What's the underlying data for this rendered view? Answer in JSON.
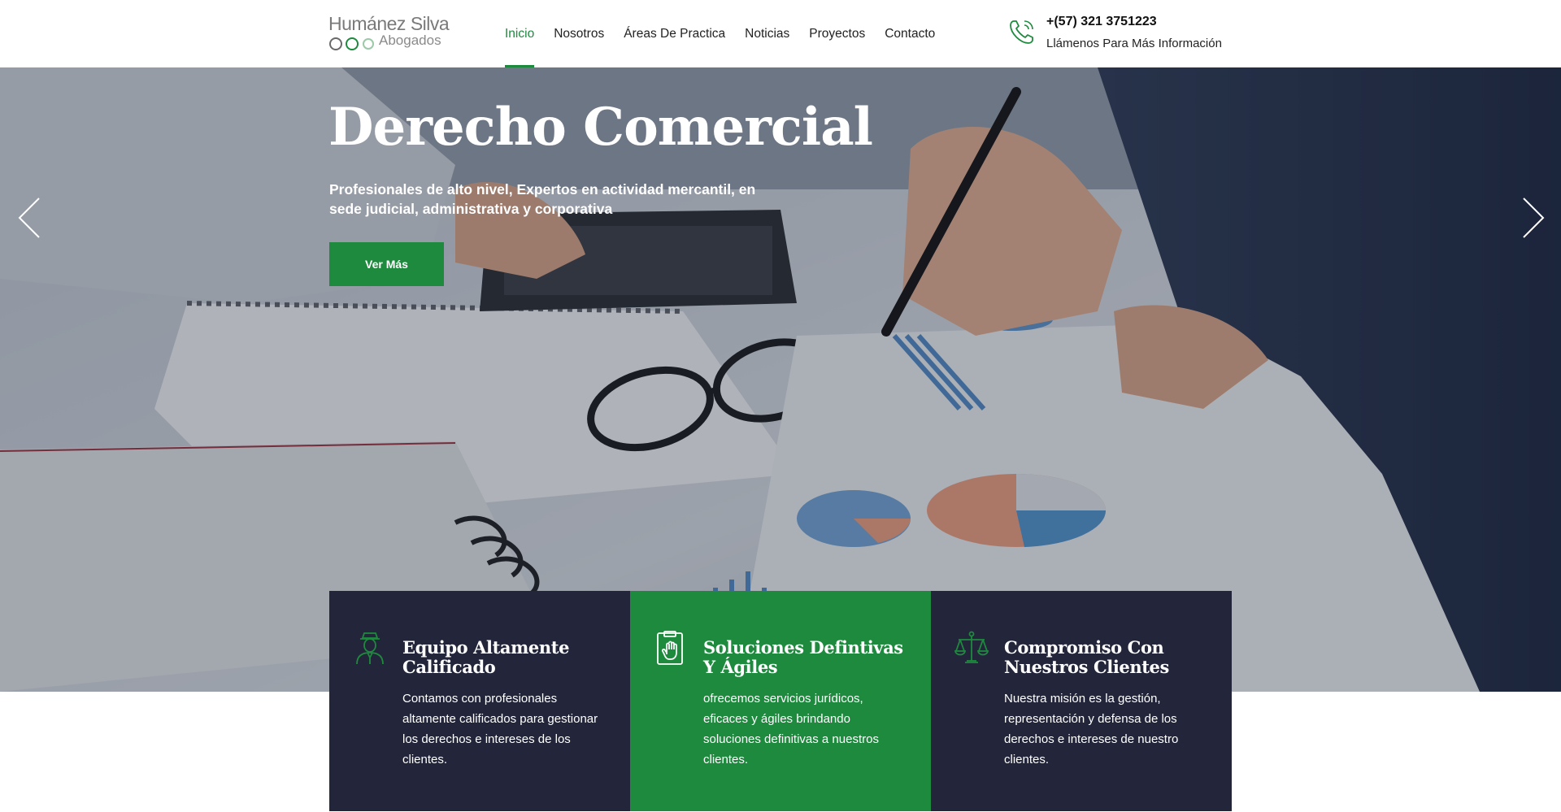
{
  "brand": {
    "name": "Humánez Silva",
    "subtitle": "Abogados",
    "green": "#1e8a3e",
    "navy": "#23263a"
  },
  "nav": {
    "items": [
      {
        "label": "Inicio",
        "active": true
      },
      {
        "label": "Nosotros"
      },
      {
        "label": "Áreas De Practica"
      },
      {
        "label": "Noticias"
      },
      {
        "label": "Proyectos"
      },
      {
        "label": "Contacto"
      }
    ]
  },
  "contact": {
    "icon": "phone-icon",
    "phone": "+(57) 321 3751223",
    "cta": "Llámenos Para Más Información"
  },
  "hero": {
    "title": "Derecho Comercial",
    "subtitle": "Profesionales de alto nivel, Expertos en actividad mercantil, en sede judicial, administrativa y corporativa",
    "button": "Ver Más",
    "prev_icon": "chevron-left-icon",
    "next_icon": "chevron-right-icon"
  },
  "features": [
    {
      "icon": "lawyer-icon",
      "title": "Equipo Altamente Calificado",
      "text": "Contamos con profesionales altamente calificados para gestionar los derechos e intereses de los clientes."
    },
    {
      "icon": "document-hand-icon",
      "title": "Soluciones Defintivas Y Ágiles",
      "text": "ofrecemos servicios jurídicos, eficaces y ágiles brindando soluciones definitivas a nuestros clientes."
    },
    {
      "icon": "scales-icon",
      "title": "Compromiso Con Nuestros Clientes",
      "text": "Nuestra misión es la gestión, representación y defensa de los derechos e intereses de nuestro clientes."
    }
  ]
}
